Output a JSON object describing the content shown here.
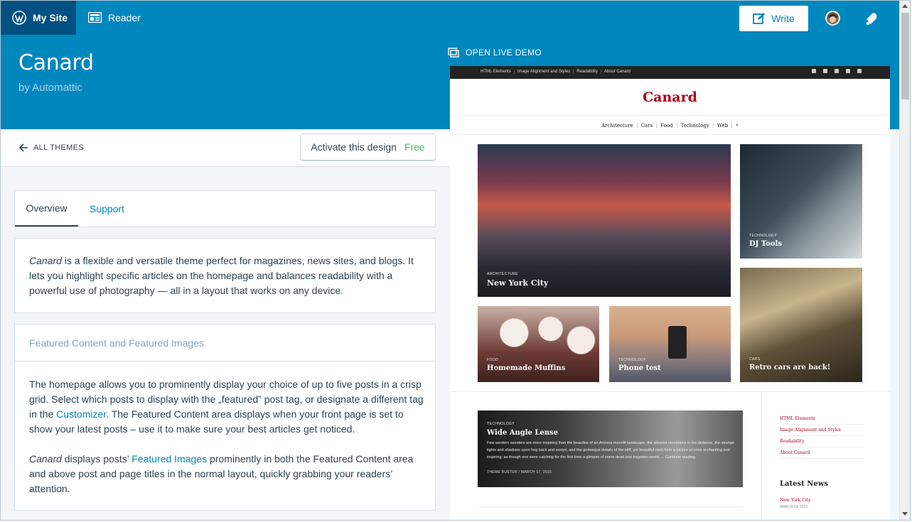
{
  "masterbar": {
    "my_site": "My Site",
    "reader": "Reader",
    "write": "Write",
    "accent": "#0087be"
  },
  "theme": {
    "name": "Canard",
    "author": "by Automattic",
    "live_demo": "OPEN LIVE DEMO"
  },
  "subbar": {
    "all_themes": "ALL THEMES",
    "activate": "Activate this design",
    "price": "Free"
  },
  "tabs": [
    "Overview",
    "Support"
  ],
  "description": {
    "em": "Canard",
    "rest": " is a flexible and versatile theme perfect for magazines, news sites, and blogs. It lets you highlight specific articles on the homepage and balances readability with a powerful use of photography — all in a layout that works on any device."
  },
  "featured": {
    "heading": "Featured Content and Featured Images",
    "p1_a": "The homepage allows you to prominently display your choice of up to five posts in a crisp grid. Select which posts to display with the „featured” post tag, or designate a different tag in the ",
    "p1_link": "Customizer",
    "p1_b": ". The Featured Content area displays when your front page is set to show your latest posts – use it to make sure your best articles get noticed.",
    "p2_em": "Canard",
    "p2_a": " displays posts’ ",
    "p2_link": "Featured Images",
    "p2_b": " prominently in both the Featured Content area and above post and page titles in the normal layout, quickly grabbing your readers’ attention."
  },
  "preview": {
    "top_links": [
      "HTML Elements",
      "Image Alignment and Styles",
      "Readability",
      "About Canard"
    ],
    "logo": "Canard",
    "nav": [
      "Architecture",
      "Cars",
      "Food",
      "Technology",
      "Web"
    ],
    "tiles": {
      "ny": {
        "cat": "ARCHITECTURE",
        "title": "New York City"
      },
      "dj": {
        "cat": "TECHNOLOGY",
        "title": "DJ Tools"
      },
      "muffins": {
        "cat": "FOOD",
        "title": "Homemade Muffins"
      },
      "phone": {
        "cat": "TECHNOLOGY",
        "title": "Phone test"
      },
      "cars": {
        "cat": "CARS",
        "title": "Retro cars are back!"
      },
      "wide": {
        "cat": "TECHNOLOGY",
        "title": "Wide Angle Lense",
        "excerpt": "Few western wonders are more inspiring than the beauties of an Arizona moonlit landscape; the silvered mountains in the distance, the strange lights and shadows upon hog back and arroyo, and the grotesque details of the stiff, yet beautiful cacti form a picture at once enchanting and inspiring; as though one were catching for the first time a glimpse of some dead and forgotten world, ... Continue reading",
        "meta": "THEME BUSTER / MARCH 17, 2015"
      }
    },
    "sidebar_links": [
      "HTML Elements",
      "Image Alignment and Styles",
      "Readability",
      "About Canard"
    ],
    "latest_news": "Latest News",
    "latest_item": "New York City",
    "latest_date": "MARCH 23, 2013"
  }
}
